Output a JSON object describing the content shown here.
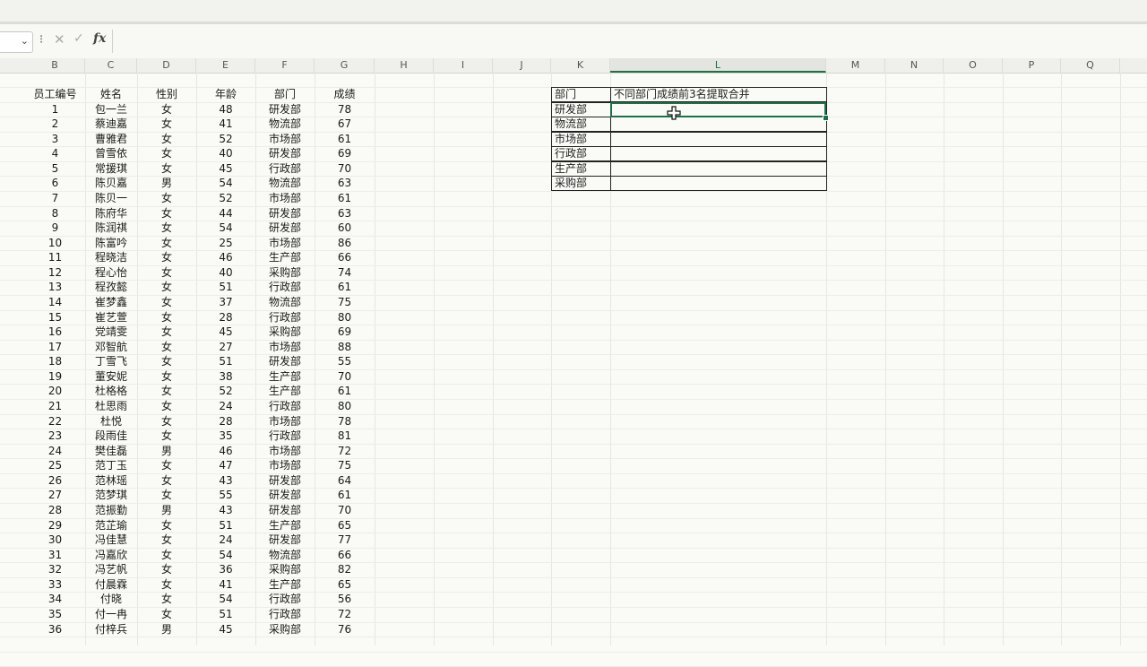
{
  "formula_bar": {
    "name_box_chevron": "⌄",
    "more": "⁝",
    "cancel_glyph": "✕",
    "enter_glyph": "✓",
    "fx_label": "fx",
    "formula_value": ""
  },
  "columns": [
    "B",
    "C",
    "D",
    "E",
    "F",
    "G",
    "H",
    "I",
    "J",
    "K",
    "L",
    "M",
    "N",
    "O",
    "P",
    "Q"
  ],
  "selected_column": "L",
  "data_headers": [
    "员工编号",
    "姓名",
    "性别",
    "年龄",
    "部门",
    "成绩"
  ],
  "rows": [
    [
      "1",
      "包一兰",
      "女",
      "48",
      "研发部",
      "78"
    ],
    [
      "2",
      "蔡迪嘉",
      "女",
      "41",
      "物流部",
      "67"
    ],
    [
      "3",
      "曹雅君",
      "女",
      "52",
      "市场部",
      "61"
    ],
    [
      "4",
      "曾雪依",
      "女",
      "40",
      "研发部",
      "69"
    ],
    [
      "5",
      "常援琪",
      "女",
      "45",
      "行政部",
      "70"
    ],
    [
      "6",
      "陈贝嘉",
      "男",
      "54",
      "物流部",
      "63"
    ],
    [
      "7",
      "陈贝一",
      "女",
      "52",
      "市场部",
      "61"
    ],
    [
      "8",
      "陈府华",
      "女",
      "44",
      "研发部",
      "63"
    ],
    [
      "9",
      "陈润祺",
      "女",
      "54",
      "研发部",
      "60"
    ],
    [
      "10",
      "陈富吟",
      "女",
      "25",
      "市场部",
      "86"
    ],
    [
      "11",
      "程晓洁",
      "女",
      "46",
      "生产部",
      "66"
    ],
    [
      "12",
      "程心怡",
      "女",
      "40",
      "采购部",
      "74"
    ],
    [
      "13",
      "程孜懿",
      "女",
      "51",
      "行政部",
      "61"
    ],
    [
      "14",
      "崔梦鑫",
      "女",
      "37",
      "物流部",
      "75"
    ],
    [
      "15",
      "崔艺萱",
      "女",
      "28",
      "行政部",
      "80"
    ],
    [
      "16",
      "党靖雯",
      "女",
      "45",
      "采购部",
      "69"
    ],
    [
      "17",
      "邓智航",
      "女",
      "27",
      "市场部",
      "88"
    ],
    [
      "18",
      "丁雪飞",
      "女",
      "51",
      "研发部",
      "55"
    ],
    [
      "19",
      "董安妮",
      "女",
      "38",
      "生产部",
      "70"
    ],
    [
      "20",
      "杜格格",
      "女",
      "52",
      "生产部",
      "61"
    ],
    [
      "21",
      "杜思雨",
      "女",
      "24",
      "行政部",
      "80"
    ],
    [
      "22",
      "杜悦",
      "女",
      "28",
      "市场部",
      "78"
    ],
    [
      "23",
      "段雨佳",
      "女",
      "35",
      "行政部",
      "81"
    ],
    [
      "24",
      "樊佳磊",
      "男",
      "46",
      "市场部",
      "72"
    ],
    [
      "25",
      "范丁玉",
      "女",
      "47",
      "市场部",
      "75"
    ],
    [
      "26",
      "范林瑶",
      "女",
      "43",
      "研发部",
      "64"
    ],
    [
      "27",
      "范梦琪",
      "女",
      "55",
      "研发部",
      "61"
    ],
    [
      "28",
      "范振勤",
      "男",
      "43",
      "研发部",
      "70"
    ],
    [
      "29",
      "范芷瑜",
      "女",
      "51",
      "生产部",
      "65"
    ],
    [
      "30",
      "冯佳慧",
      "女",
      "24",
      "研发部",
      "77"
    ],
    [
      "31",
      "冯嘉欣",
      "女",
      "54",
      "物流部",
      "66"
    ],
    [
      "32",
      "冯艺帆",
      "女",
      "36",
      "采购部",
      "82"
    ],
    [
      "33",
      "付晨霖",
      "女",
      "41",
      "生产部",
      "65"
    ],
    [
      "34",
      "付晓",
      "女",
      "54",
      "行政部",
      "56"
    ],
    [
      "35",
      "付一冉",
      "女",
      "51",
      "行政部",
      "72"
    ],
    [
      "36",
      "付梓兵",
      "男",
      "45",
      "采购部",
      "76"
    ]
  ],
  "summary": {
    "header_dept": "部门",
    "header_result": "不同部门成绩前3名提取合并",
    "departments": [
      "研发部",
      "物流部",
      "市场部",
      "行政部",
      "生产部",
      "采购部"
    ]
  }
}
